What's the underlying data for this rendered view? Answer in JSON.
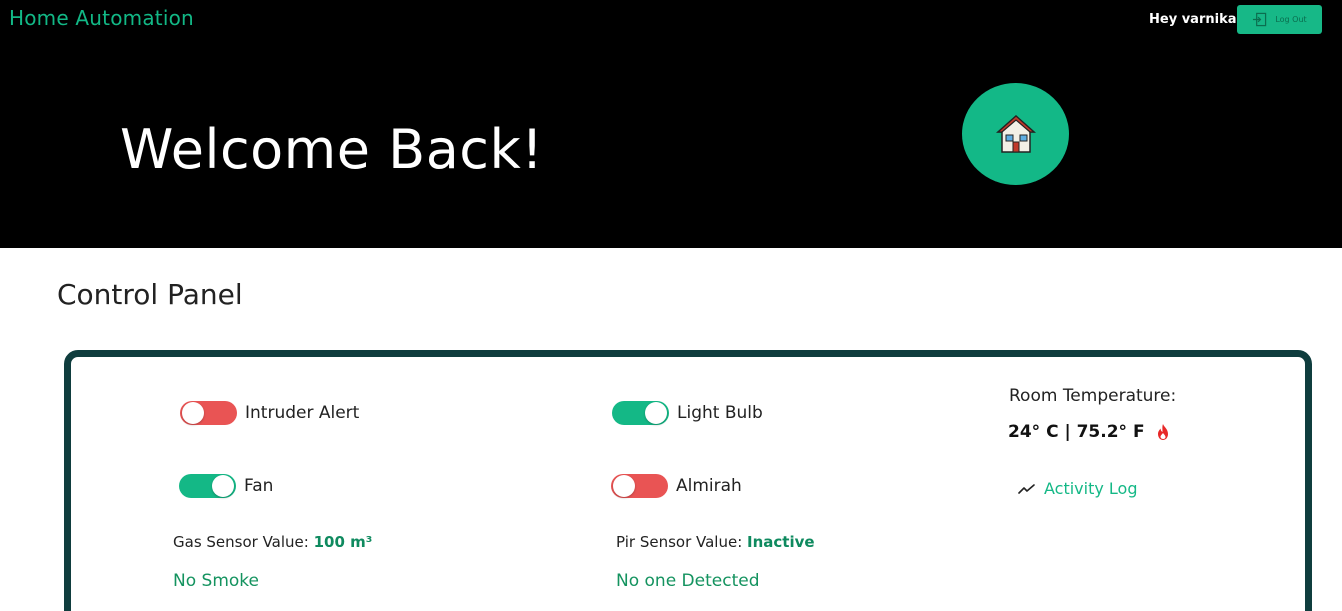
{
  "header": {
    "brand": "Home Automation",
    "greeting": "Hey varnika",
    "logout_label": "Log Out",
    "welcome": "Welcome Back!"
  },
  "control_panel": {
    "title": "Control Panel",
    "toggles": [
      {
        "label": "Intruder Alert",
        "state": "off"
      },
      {
        "label": "Light Bulb",
        "state": "on"
      },
      {
        "label": "Fan",
        "state": "on"
      },
      {
        "label": "Almirah",
        "state": "off"
      }
    ],
    "gas_sensor": {
      "label": "Gas Sensor Value:",
      "value": "100 m³",
      "status": "No Smoke"
    },
    "pir_sensor": {
      "label": "Pir Sensor Value:",
      "value": "Inactive",
      "status": "No one Detected"
    },
    "temperature": {
      "label": "Room Temperature:",
      "value": "24° C | 75.2° F",
      "icon": "fire-icon"
    },
    "activity_log_label": "Activity Log"
  },
  "colors": {
    "accent": "#14b886",
    "off": "#e95454",
    "panel_border": "#0f3d3e",
    "hero_bg": "#000000"
  }
}
